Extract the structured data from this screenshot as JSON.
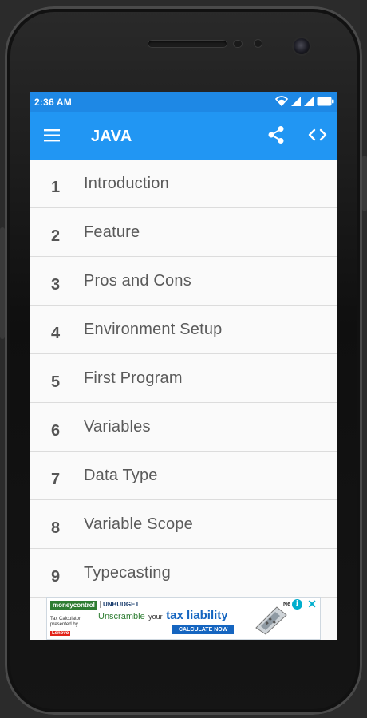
{
  "status_bar": {
    "time": "2:36 AM",
    "icons": [
      "wifi-icon",
      "signal-icon",
      "signal-icon",
      "battery-icon"
    ]
  },
  "app_bar": {
    "title": "JAVA",
    "menu_icon": "menu-icon",
    "share_icon": "share-icon",
    "code_icon": "code-icon",
    "color": "#2196f3",
    "status_color": "#1e88e5"
  },
  "topics": [
    {
      "num": "1",
      "label": "Introduction"
    },
    {
      "num": "2",
      "label": "Feature"
    },
    {
      "num": "3",
      "label": "Pros and Cons"
    },
    {
      "num": "4",
      "label": "Environment Setup"
    },
    {
      "num": "5",
      "label": "First Program"
    },
    {
      "num": "6",
      "label": "Variables"
    },
    {
      "num": "7",
      "label": "Data Type"
    },
    {
      "num": "8",
      "label": "Variable Scope"
    },
    {
      "num": "9",
      "label": "Typecasting"
    }
  ],
  "ad": {
    "brand": "moneycontrol",
    "campaign": "UNBUDGET",
    "subtext": "Tax Calculator presented by",
    "sponsor": "Lenovo",
    "headline_1": "Unscramble",
    "headline_2": "your",
    "headline_3": "tax liability",
    "cta": "CALCULATE NOW",
    "ne_text": "Ne",
    "info_icon": "i",
    "close_icon": "✕"
  }
}
